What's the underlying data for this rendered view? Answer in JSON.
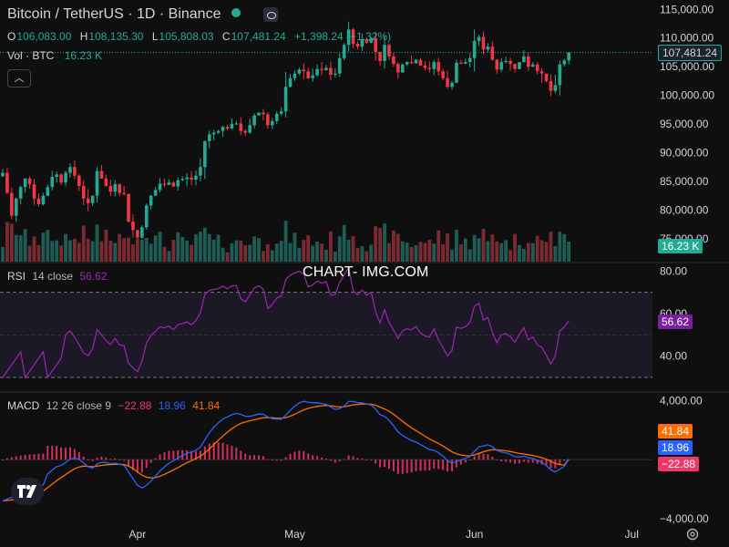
{
  "header": {
    "title": "Bitcoin / TetherUS · 1D · Binance",
    "ohlc": {
      "o_label": "O",
      "o": "106,083.00",
      "h_label": "H",
      "h": "108,135.30",
      "l_label": "L",
      "l": "105,808.03",
      "c_label": "C",
      "c": "107,481.24",
      "change": "+1,398.24 (+1.32%)"
    },
    "vol_label": "Vol · BTC",
    "vol_value": "16.23 K"
  },
  "watermark": "CHART- IMG.COM",
  "rsi_legend": {
    "name": "RSI",
    "params": "14 close",
    "value": "56.62"
  },
  "macd_legend": {
    "name": "MACD",
    "params": "12 26 close 9",
    "hist": "−22.88",
    "macd": "18.96",
    "signal": "41.84"
  },
  "tags": {
    "price": "107,481.24",
    "volume": "16.23 K",
    "rsi": "56.62",
    "macd_signal": "41.84",
    "macd_line": "18.96",
    "macd_hist": "−22.88"
  },
  "colors": {
    "up": "#22ab94",
    "down": "#f23645",
    "up_vol": "#1e5d55",
    "down_vol": "#7a2a30",
    "rsi": "#9c27b0",
    "macd": "#2962ff",
    "signal": "#ff6d00",
    "hist": "#f23669"
  },
  "chart_data": [
    {
      "type": "candlestick",
      "title": "Bitcoin / TetherUS · 1D · Binance",
      "price_axis_ticks": [
        "115,000.00",
        "110,000.00",
        "105,000.00",
        "100,000.00",
        "95,000.00",
        "90,000.00",
        "85,000.00",
        "80,000.00",
        "75,000.00"
      ],
      "ylim": [
        71000,
        116000
      ],
      "time_axis_labels": [
        "Apr",
        "May",
        "Jun",
        "Jul"
      ],
      "last_price": 107481.24,
      "closes": [
        86500,
        83000,
        79000,
        82000,
        84000,
        85500,
        84500,
        82000,
        81000,
        82500,
        84000,
        85800,
        86200,
        84800,
        86500,
        87500,
        86000,
        84200,
        82000,
        81200,
        82500,
        86800,
        85500,
        84200,
        83200,
        84500,
        83000,
        82800,
        78000,
        76500,
        75200,
        77000,
        80800,
        82500,
        83500,
        84600,
        84400,
        84800,
        84100,
        85200,
        85400,
        85700,
        85300,
        86000,
        87500,
        92000,
        93200,
        93500,
        93800,
        94500,
        94200,
        95000,
        95100,
        93800,
        93500,
        94800,
        96500,
        97000,
        96700,
        94800,
        95500,
        96800,
        97200,
        101500,
        103000,
        103800,
        104500,
        104200,
        103000,
        103500,
        104600,
        104400,
        104800,
        103600,
        103800,
        106500,
        108800,
        111500,
        109000,
        108500,
        109800,
        109200,
        110000,
        107600,
        106000,
        108800,
        106800,
        105500,
        104000,
        105400,
        105800,
        105600,
        106200,
        105200,
        104800,
        104600,
        105800,
        104200,
        103000,
        101500,
        102200,
        105700,
        105500,
        105800,
        106500,
        109500,
        110200,
        108000,
        108500,
        106200,
        104500,
        105800,
        106000,
        105500,
        104600,
        105800,
        106800,
        105000,
        105400,
        104200,
        103800,
        102500,
        100800,
        101800,
        105400,
        106083,
        107481
      ],
      "volume_note": "volume bars shown per candle, last 16.23 K BTC"
    },
    {
      "type": "line",
      "title": "RSI",
      "params": "14 close",
      "axis_ticks": [
        "80.00",
        "60.00",
        "40.00"
      ],
      "bands": [
        70,
        30
      ],
      "ylim": [
        24,
        84
      ],
      "last_value": 56.62
    },
    {
      "type": "line",
      "title": "MACD",
      "params": "12 26 close 9",
      "axis_ticks": [
        "4,000.00",
        "−4,000.00"
      ],
      "ylim": [
        -4200,
        4600
      ],
      "last_macd": 18.96,
      "last_signal": 41.84,
      "last_histogram": -22.88
    }
  ]
}
